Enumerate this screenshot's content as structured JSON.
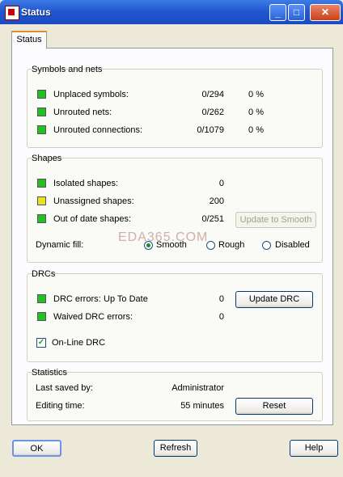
{
  "window": {
    "title": "Status",
    "minimize_glyph": "_",
    "maximize_glyph": "□",
    "close_glyph": "✕"
  },
  "tabs": [
    {
      "label": "Status",
      "active": true
    }
  ],
  "symbols_and_nets": {
    "heading": "Symbols and nets",
    "rows": [
      {
        "label": "Unplaced symbols:",
        "value": "0/294",
        "percent": "0 %",
        "status_color": "#22c022"
      },
      {
        "label": "Unrouted nets:",
        "value": "0/262",
        "percent": "0 %",
        "status_color": "#22c022"
      },
      {
        "label": "Unrouted connections:",
        "value": "0/1079",
        "percent": "0 %",
        "status_color": "#22c022"
      }
    ]
  },
  "shapes": {
    "heading": "Shapes",
    "rows": [
      {
        "label": "Isolated shapes:",
        "value": "0",
        "status_color": "#22c022"
      },
      {
        "label": "Unassigned shapes:",
        "value": "200",
        "status_color": "#e8e020"
      },
      {
        "label": "Out of date shapes:",
        "value": "0/251",
        "status_color": "#22c022"
      }
    ],
    "update_button": "Update to Smooth",
    "dynamic_fill_label": "Dynamic fill:",
    "fill_options": [
      "Smooth",
      "Rough",
      "Disabled"
    ],
    "fill_selected": "Smooth"
  },
  "drcs": {
    "heading": "DRCs",
    "rows": [
      {
        "label": "DRC errors:",
        "state": "Up To Date",
        "value": "0",
        "status_color": "#22c022"
      },
      {
        "label": "Waived DRC errors:",
        "value": "0",
        "status_color": "#22c022"
      }
    ],
    "update_button": "Update DRC",
    "online_drc_label": "On-Line DRC",
    "online_drc_checked": true
  },
  "statistics": {
    "heading": "Statistics",
    "last_saved_label": "Last saved by:",
    "last_saved_value": "Administrator",
    "editing_time_label": "Editing time:",
    "editing_time_value": "55 minutes",
    "reset_button": "Reset"
  },
  "footer": {
    "ok": "OK",
    "refresh": "Refresh",
    "help": "Help"
  },
  "watermark": "EDA365.COM"
}
